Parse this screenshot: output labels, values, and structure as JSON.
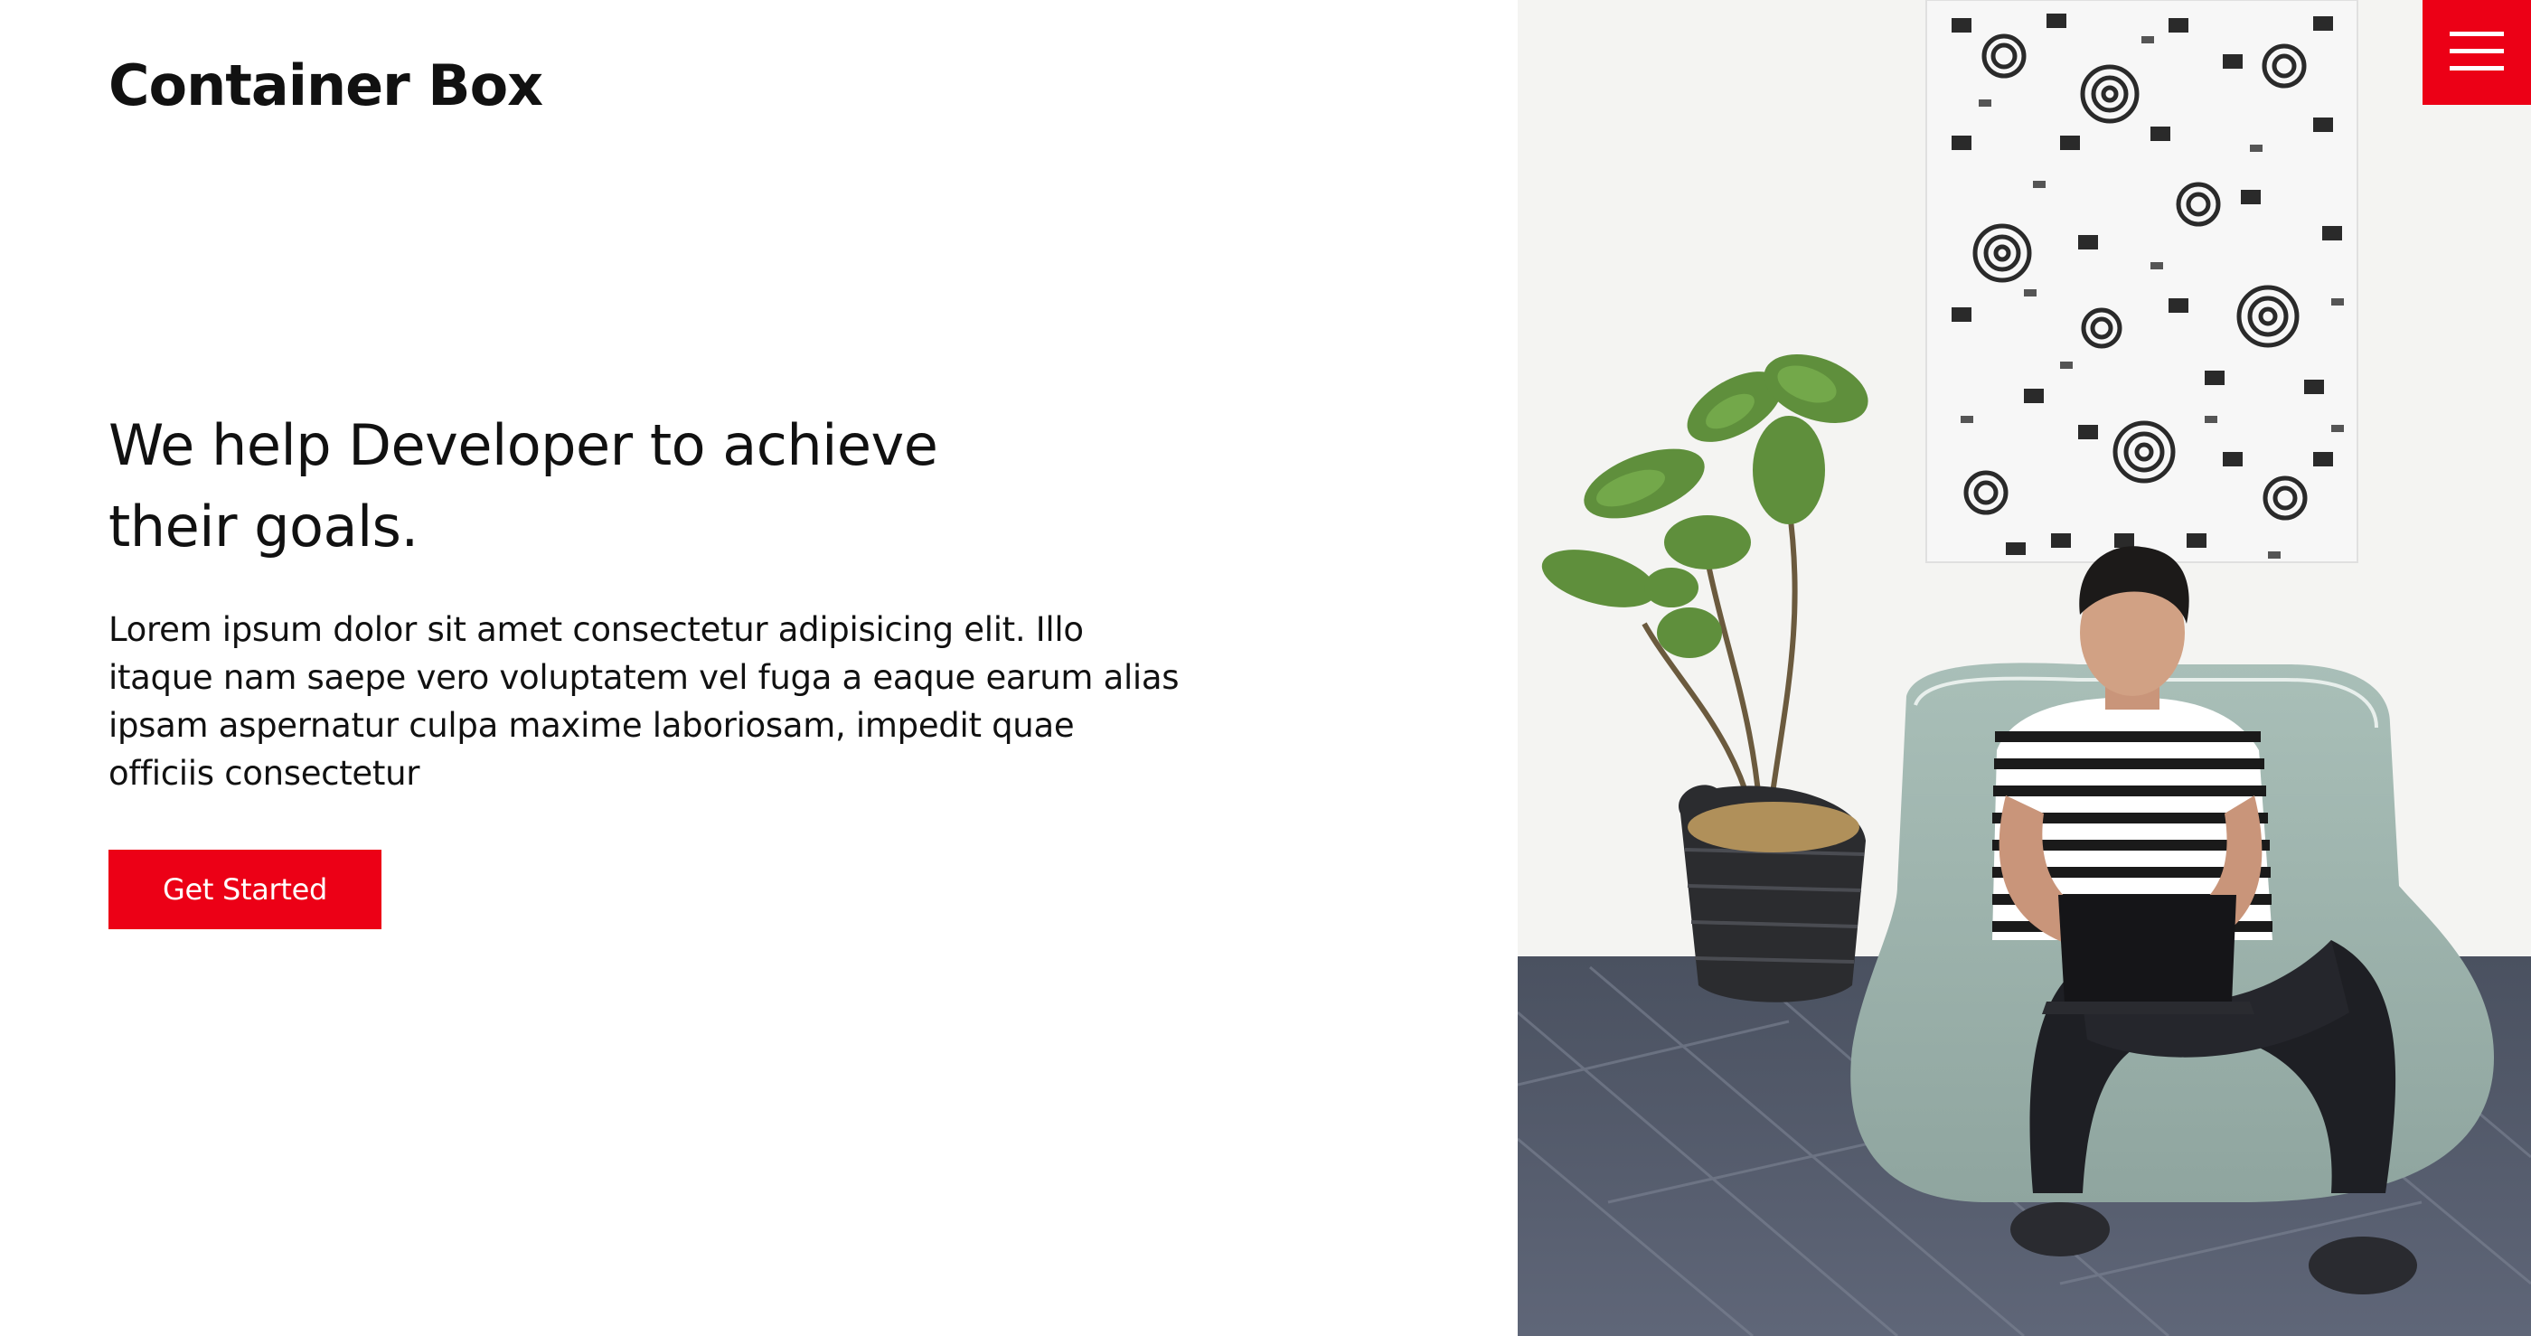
{
  "header": {
    "brand": "Container Box",
    "menu_icon": "hamburger-menu-icon"
  },
  "hero": {
    "title": "We help Developer to achieve their goals.",
    "description": "Lorem ipsum dolor sit amet consectetur adipisicing elit. Illo itaque nam saepe vero voluptatem vel fuga a eaque earum alias ipsam aspernatur culpa maxime laboriosam, impedit quae officiis consectetur",
    "cta_label": "Get Started"
  },
  "colors": {
    "accent": "#ec0016",
    "text": "#111111",
    "background": "#ffffff"
  }
}
